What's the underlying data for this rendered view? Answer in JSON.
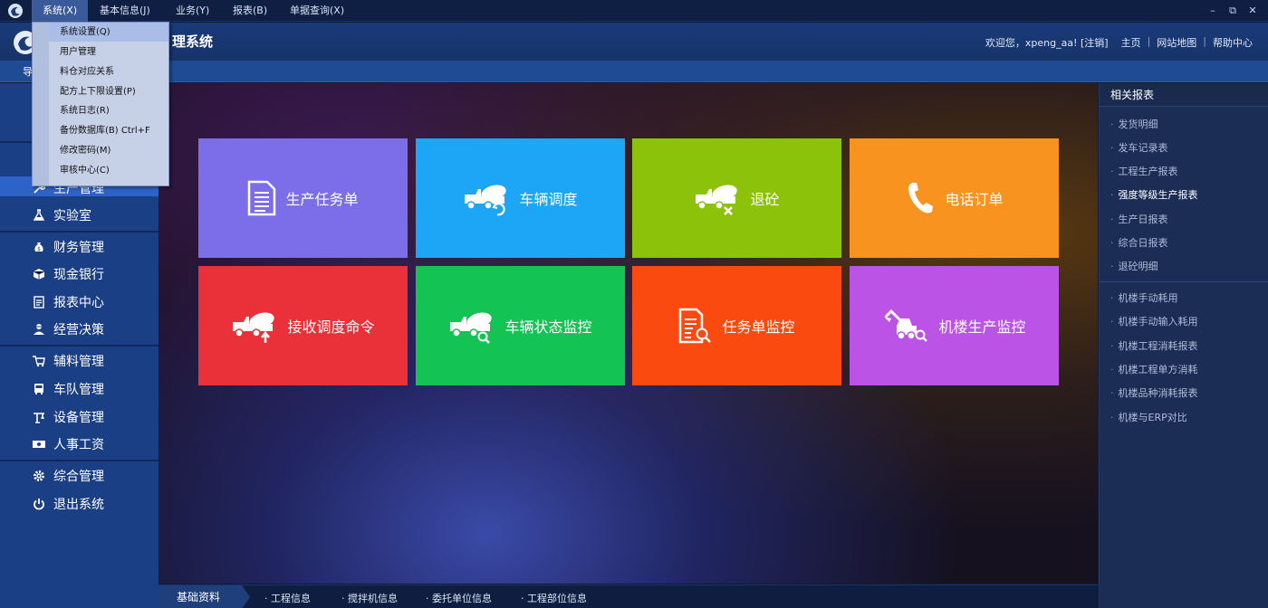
{
  "menubar": {
    "items": [
      "系统(X)",
      "基本信息(J)",
      "业务(Y)",
      "报表(B)",
      "单据查询(X)"
    ],
    "window_controls": [
      "–",
      "⧉",
      "✕"
    ]
  },
  "header": {
    "title": "理系统",
    "welcome": "欢迎您，xpeng_aa! [注销]",
    "links": [
      "主页",
      "网站地图",
      "帮助中心"
    ]
  },
  "subbar": {
    "nav_label": "导"
  },
  "dropdown": {
    "items": [
      "系统设置(Q)",
      "用户管理",
      "料仓对应关系",
      "配方上下限设置(P)",
      "系统日志(R)",
      "备份数据库(B) Ctrl+F",
      "修改密码(M)",
      "审核中心(C)"
    ]
  },
  "sidebar": {
    "items": [
      {
        "label": "生产管理",
        "icon": "wrench-icon"
      },
      {
        "label": "实验室",
        "icon": "flask-icon"
      },
      {
        "label": "财务管理",
        "icon": "money-bag-icon"
      },
      {
        "label": "现金银行",
        "icon": "box-icon"
      },
      {
        "label": "报表中心",
        "icon": "report-icon"
      },
      {
        "label": "经营决策",
        "icon": "user-tie-icon"
      },
      {
        "label": "辅料管理",
        "icon": "cart-icon"
      },
      {
        "label": "车队管理",
        "icon": "bus-icon"
      },
      {
        "label": "设备管理",
        "icon": "crane-icon"
      },
      {
        "label": "人事工资",
        "icon": "cash-icon"
      },
      {
        "label": "综合管理",
        "icon": "gear-icon"
      },
      {
        "label": "退出系统",
        "icon": "power-icon"
      }
    ]
  },
  "tiles": [
    {
      "label": "生产任务单",
      "icon": "document-icon",
      "color": "#7b6ee8"
    },
    {
      "label": "车辆调度",
      "icon": "mixer-truck-refresh-icon",
      "color": "#1ca6f5"
    },
    {
      "label": "退砼",
      "icon": "mixer-truck-cancel-icon",
      "color": "#8cc20a"
    },
    {
      "label": "电话订单",
      "icon": "phone-icon",
      "color": "#f7931e"
    },
    {
      "label": "接收调度命令",
      "icon": "mixer-truck-receive-icon",
      "color": "#ea3039"
    },
    {
      "label": "车辆状态监控",
      "icon": "mixer-truck-search-icon",
      "color": "#13c354"
    },
    {
      "label": "任务单监控",
      "icon": "document-search-icon",
      "color": "#fa4a0f"
    },
    {
      "label": "机楼生产监控",
      "icon": "excavator-search-icon",
      "color": "#bb54e6"
    }
  ],
  "bottombar": {
    "category": "基础资料",
    "links": [
      "工程信息",
      "搅拌机信息",
      "委托单位信息",
      "工程部位信息"
    ]
  },
  "rightpanel": {
    "title": "相关报表",
    "group1": [
      "发货明细",
      "发车记录表",
      "工程生产报表",
      "强度等级生产报表",
      "生产日报表",
      "综合日报表",
      "退砼明细"
    ],
    "group2": [
      "机楼手动耗用",
      "机楼手动输入耗用",
      "机楼工程消耗报表",
      "机楼工程单方消耗",
      "机楼品种消耗报表",
      "机楼与ERP对比"
    ]
  }
}
